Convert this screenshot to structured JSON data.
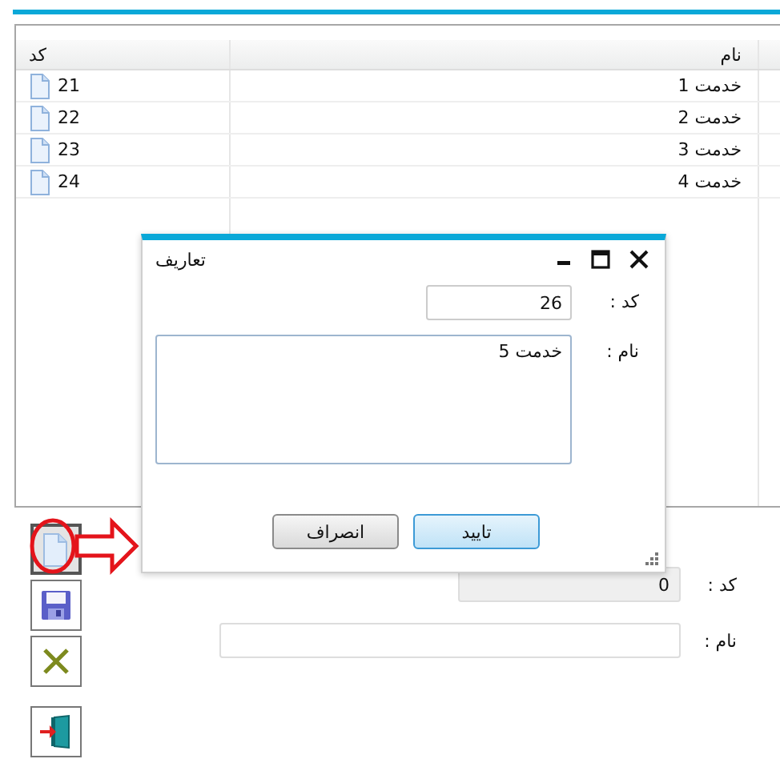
{
  "list": {
    "columns": [
      {
        "label": "نام"
      },
      {
        "label": "کد"
      }
    ],
    "rows": [
      {
        "name": "خدمت 1",
        "code": "21"
      },
      {
        "name": "خدمت 2",
        "code": "22"
      },
      {
        "name": "خدمت 3",
        "code": "23"
      },
      {
        "name": "خدمت 4",
        "code": "24"
      }
    ]
  },
  "toolbar": {
    "buttons": [
      {
        "kind": "new",
        "selected": true,
        "highlighted": true
      },
      {
        "kind": "save",
        "selected": false,
        "highlighted": false
      },
      {
        "kind": "delete",
        "selected": false,
        "highlighted": false
      },
      {
        "kind": "exit",
        "selected": false,
        "highlighted": false
      }
    ]
  },
  "form": {
    "fields": [
      {
        "label": "کد :",
        "value": "0",
        "disabled": true,
        "kind": "short"
      },
      {
        "label": "نام :",
        "disabled": false,
        "kind": "long"
      }
    ]
  },
  "dialog": {
    "title": "تعاریف",
    "fields": [
      {
        "label": "کد :",
        "value": "26",
        "kind": "input"
      },
      {
        "label": "نام :",
        "value": "خدمت 5",
        "kind": "textarea"
      }
    ],
    "buttons": [
      {
        "label": "تایید",
        "kind": "primary"
      },
      {
        "label": "انصراف",
        "kind": "default"
      }
    ]
  }
}
